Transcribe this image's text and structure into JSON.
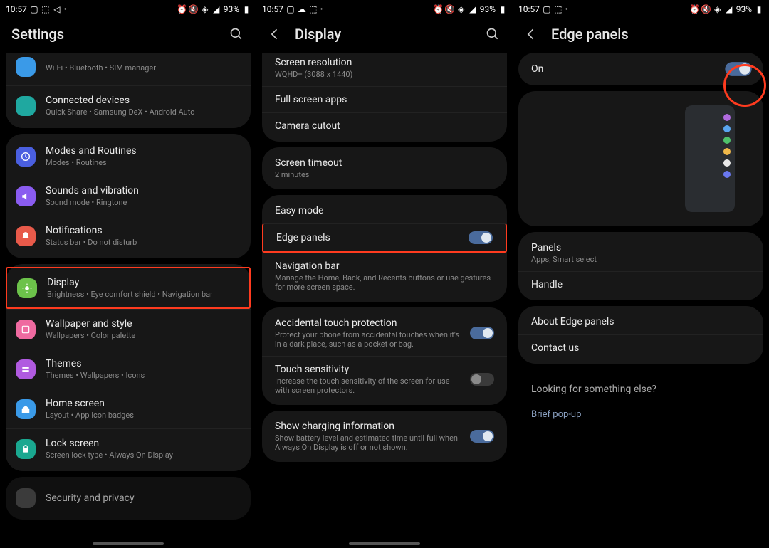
{
  "status": {
    "time": "10:57",
    "battery": "93%"
  },
  "pane1": {
    "title": "Settings",
    "top_partial": {
      "sub": "Wi-Fi  •  Bluetooth  •  SIM manager"
    },
    "group1": [
      {
        "label": "Connected devices",
        "sub": "Quick Share  •  Samsung DeX  •  Android Auto",
        "icon_color": "#1fa8a0"
      }
    ],
    "group2": [
      {
        "label": "Modes and Routines",
        "sub": "Modes  •  Routines",
        "icon_color": "#4a5fe0"
      },
      {
        "label": "Sounds and vibration",
        "sub": "Sound mode  •  Ringtone",
        "icon_color": "#8a5cf0"
      },
      {
        "label": "Notifications",
        "sub": "Status bar  •  Do not disturb",
        "icon_color": "#e85a4a"
      }
    ],
    "group3": [
      {
        "label": "Display",
        "sub": "Brightness  •  Eye comfort shield  •  Navigation bar",
        "icon_color": "#6cc24a",
        "highlight": true
      },
      {
        "label": "Wallpaper and style",
        "sub": "Wallpapers  •  Color palette",
        "icon_color": "#ef6aa0"
      },
      {
        "label": "Themes",
        "sub": "Themes  •  Wallpapers  •  Icons",
        "icon_color": "#b05ae0"
      },
      {
        "label": "Home screen",
        "sub": "Layout  •  App icon badges",
        "icon_color": "#3a9ae8"
      },
      {
        "label": "Lock screen",
        "sub": "Screen lock type  •  Always On Display",
        "icon_color": "#1aa890"
      }
    ],
    "group4": [
      {
        "label": "Security and privacy",
        "sub": ""
      }
    ]
  },
  "pane2": {
    "title": "Display",
    "items_top": [
      {
        "label": "Screen resolution",
        "sub": "WQHD+ (3088 x 1440)"
      },
      {
        "label": "Full screen apps",
        "sub": ""
      },
      {
        "label": "Camera cutout",
        "sub": ""
      }
    ],
    "timeout": {
      "label": "Screen timeout",
      "sub": "2 minutes"
    },
    "group_edge": {
      "easy": "Easy mode",
      "edge": "Edge panels",
      "nav_label": "Navigation bar",
      "nav_sub": "Manage the Home, Back, and Recents buttons or use gestures for more screen space."
    },
    "group_touch": [
      {
        "label": "Accidental touch protection",
        "sub": "Protect your phone from accidental touches when it's in a dark place, such as a pocket or bag.",
        "toggle": "on"
      },
      {
        "label": "Touch sensitivity",
        "sub": "Increase the touch sensitivity of the screen for use with screen protectors.",
        "toggle": "off"
      }
    ],
    "charging": {
      "label": "Show charging information",
      "sub": "Show battery level and estimated time until full when Always On Display is off or not shown.",
      "toggle": "on"
    }
  },
  "pane3": {
    "title": "Edge panels",
    "on_label": "On",
    "panels_label": "Panels",
    "panels_sub": "Apps, Smart select",
    "handle_label": "Handle",
    "about_label": "About Edge panels",
    "contact_label": "Contact us",
    "looking_label": "Looking for something else?",
    "brief_label": "Brief pop-up",
    "edge_colors": [
      "#b06adf",
      "#5aa6f0",
      "#4fc26a",
      "#f0b84a",
      "#e8e8e8",
      "#6a78f0"
    ]
  }
}
